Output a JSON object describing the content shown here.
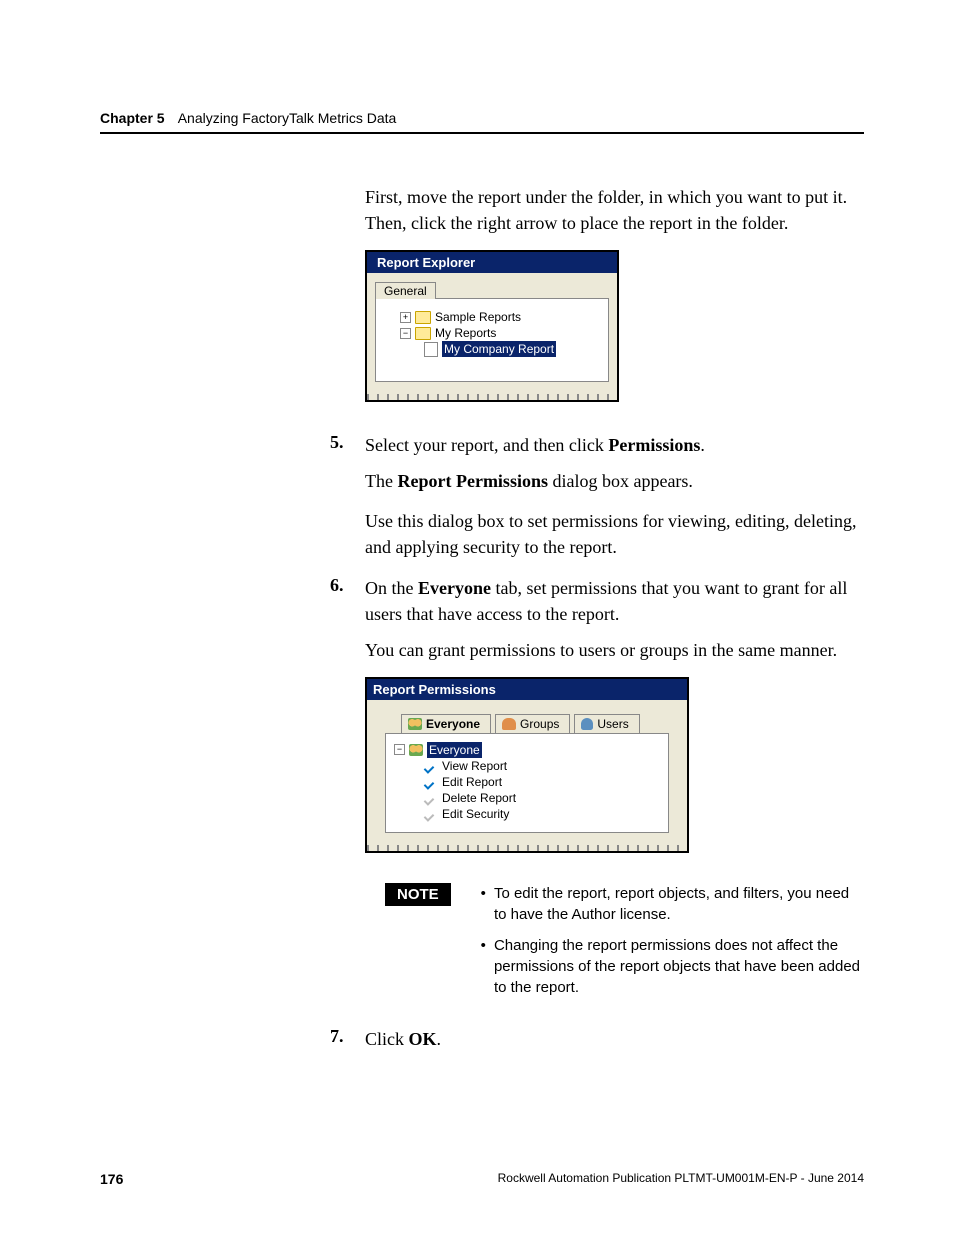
{
  "header": {
    "chapter": "Chapter 5",
    "title": "Analyzing FactoryTalk Metrics Data"
  },
  "intro_paragraph": "First, move the report under the folder, in which you want to put it. Then, click the right arrow to place the report in the folder.",
  "screenshot1": {
    "window_title": "Report Explorer",
    "tab": "General",
    "tree": {
      "item1": "Sample Reports",
      "item2": "My Reports",
      "item3": "My Company Report"
    }
  },
  "step5_num": "5.",
  "step5_a": "Select your report, and then click ",
  "step5_b": "Permissions",
  "step5_c": ".",
  "step5_p2a": "The ",
  "step5_p2b": "Report Permissions",
  "step5_p2c": " dialog box appears.",
  "step5_p3": "Use this dialog box to set permissions for viewing, editing, deleting, and applying security to the report.",
  "step6_num": "6.",
  "step6_a": "On the ",
  "step6_b": "Everyone",
  "step6_c": " tab, set permissions that you want to grant for all users that have access to the report.",
  "step6_p2": "You can grant permissions to users or groups in the same manner.",
  "screenshot2": {
    "window_title": "Report Permissions",
    "tabs": {
      "everyone": "Everyone",
      "groups": "Groups",
      "users": "Users"
    },
    "tree": {
      "root": "Everyone",
      "perm1": "View Report",
      "perm2": "Edit Report",
      "perm3": "Delete Report",
      "perm4": "Edit Security"
    }
  },
  "note": {
    "label": "NOTE",
    "bullet1": "To edit the report, report objects, and filters, you need to have the Author license.",
    "bullet2": "Changing the report permissions does not affect the permissions of the report objects that have been added to the report."
  },
  "step7_num": "7.",
  "step7_a": "Click ",
  "step7_b": "OK",
  "step7_c": ".",
  "footer": {
    "page": "176",
    "pub": "Rockwell Automation Publication PLTMT-UM001M-EN-P - June 2014"
  }
}
